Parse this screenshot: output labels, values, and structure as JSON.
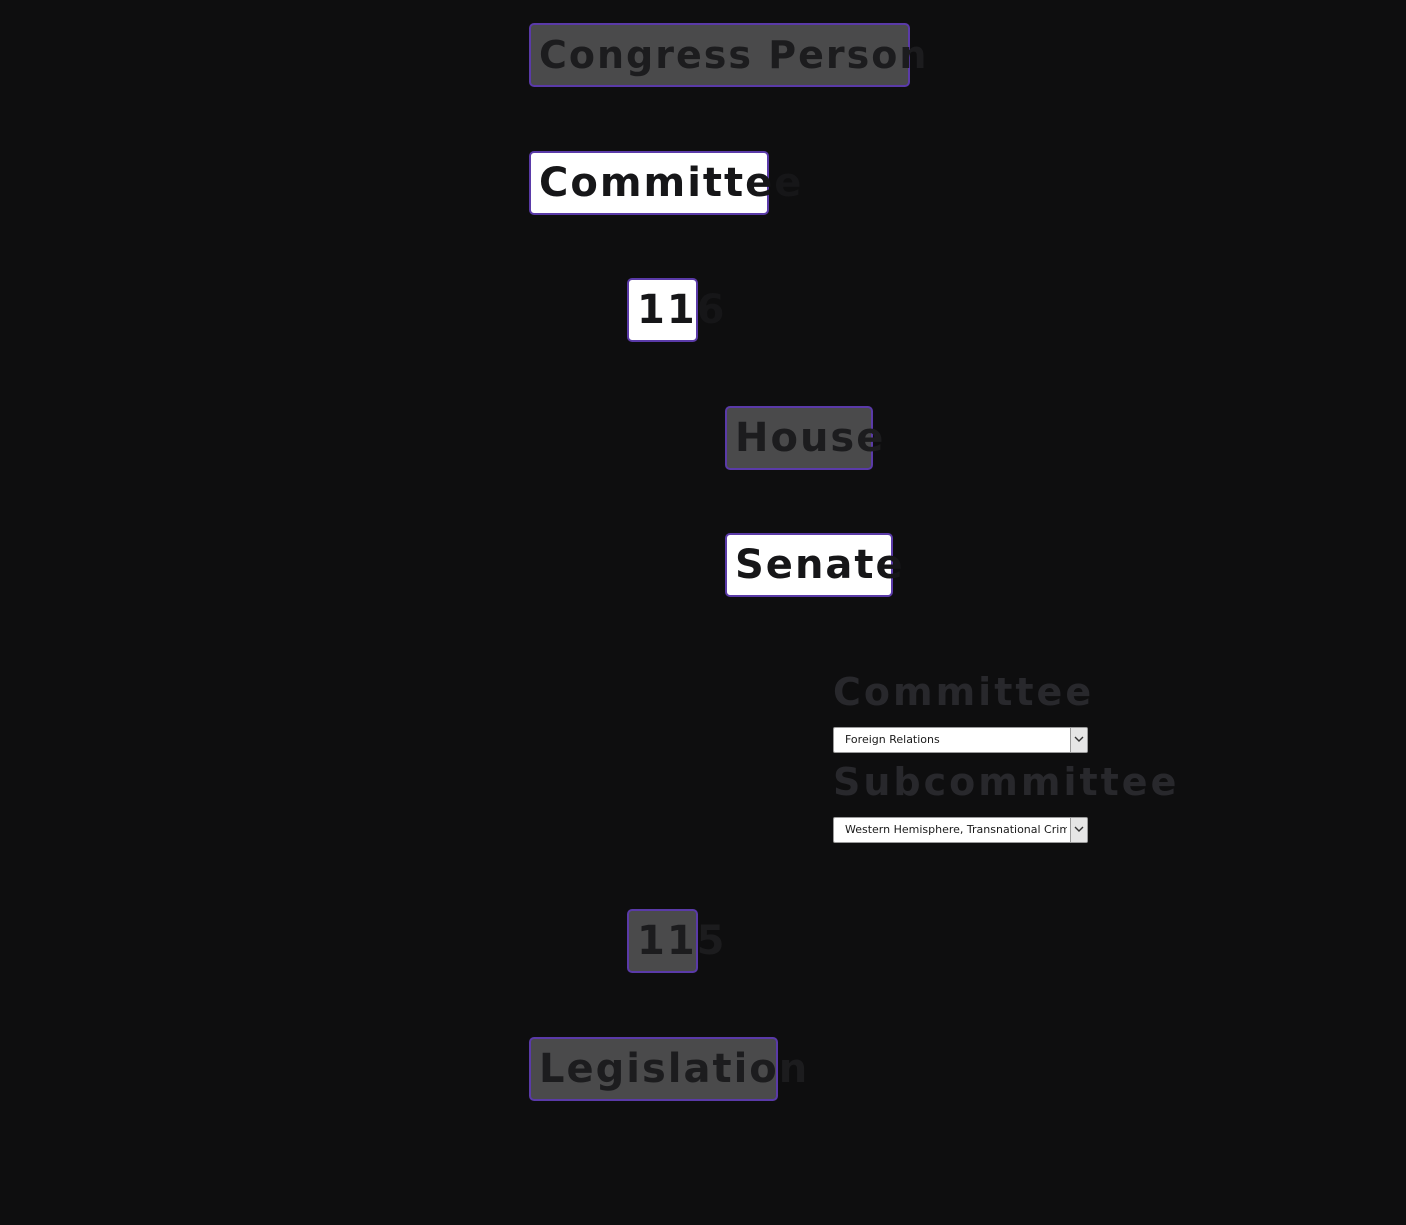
{
  "nav": {
    "congress_person": "Congress Person",
    "committee": "Committee",
    "congress_116": "116",
    "house": "House",
    "senate": "Senate",
    "congress_115": "115",
    "legislation": "Legislation"
  },
  "filters": {
    "committee_label": "Committee",
    "committee_value": "Foreign Relations",
    "subcommittee_label": "Subcommittee",
    "subcommittee_value": "Western Hemisphere, Transnational Crime"
  },
  "colors": {
    "background": "#0e0e0f",
    "accent_border": "#5a3aa8",
    "active_bg": "#ffffff",
    "inactive_bg": "#4a4a4b"
  },
  "icons": {
    "dropdown": "chevron-down-icon"
  }
}
